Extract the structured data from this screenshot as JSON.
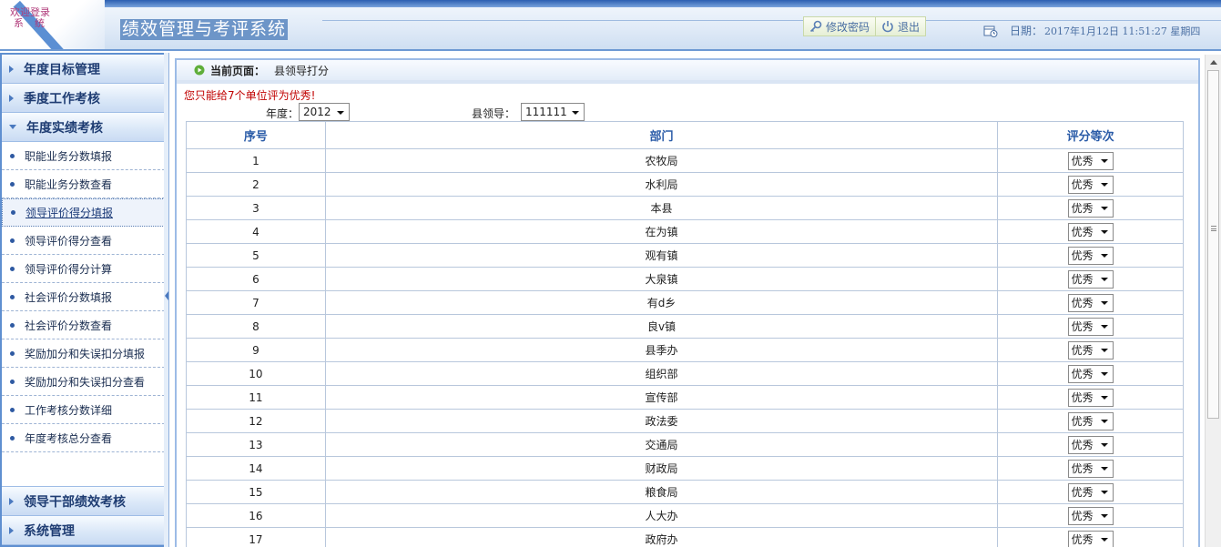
{
  "header": {
    "welcome_line1": "欢迎登录",
    "welcome_line2": "系统",
    "system_title": "绩效管理与考评系统",
    "change_password": "修改密码",
    "logout": "退出",
    "date_label": "日期：",
    "date_value": "2017年1月12日  11:51:27 星期四"
  },
  "sidebar": {
    "groups_top": [
      {
        "label": "年度目标管理"
      },
      {
        "label": "季度工作考核"
      },
      {
        "label": "年度实绩考核"
      }
    ],
    "sub_items": [
      {
        "label": "职能业务分数填报"
      },
      {
        "label": "职能业务分数查看"
      },
      {
        "label": "领导评价得分填报"
      },
      {
        "label": "领导评价得分查看"
      },
      {
        "label": "领导评价得分计算"
      },
      {
        "label": "社会评价分数填报"
      },
      {
        "label": "社会评价分数查看"
      },
      {
        "label": "奖励加分和失误扣分填报"
      },
      {
        "label": "奖励加分和失误扣分查看"
      },
      {
        "label": "工作考核分数详细"
      },
      {
        "label": "年度考核总分查看"
      }
    ],
    "groups_bottom": [
      {
        "label": "领导干部绩效考核"
      },
      {
        "label": "系统管理"
      }
    ]
  },
  "page": {
    "crumb_label": "当前页面：",
    "crumb_value": "县领导打分",
    "notice": "您只能给7个单位评为优秀!",
    "year_label": "年度：",
    "year_value": "2012",
    "leader_label": "县领导：",
    "leader_value": "111111"
  },
  "table": {
    "headers": [
      "序号",
      "部门",
      "评分等次"
    ],
    "rows": [
      {
        "no": "1",
        "dept": "农牧局",
        "rank": "优秀"
      },
      {
        "no": "2",
        "dept": "水利局",
        "rank": "优秀"
      },
      {
        "no": "3",
        "dept": "本县",
        "rank": "优秀"
      },
      {
        "no": "4",
        "dept": "在为镇",
        "rank": "优秀"
      },
      {
        "no": "5",
        "dept": "观有镇",
        "rank": "优秀"
      },
      {
        "no": "6",
        "dept": "大泉镇",
        "rank": "优秀"
      },
      {
        "no": "7",
        "dept": "有d乡",
        "rank": "优秀"
      },
      {
        "no": "8",
        "dept": "良v镇",
        "rank": "优秀"
      },
      {
        "no": "9",
        "dept": "县季办",
        "rank": "优秀"
      },
      {
        "no": "10",
        "dept": "组织部",
        "rank": "优秀"
      },
      {
        "no": "11",
        "dept": "宣传部",
        "rank": "优秀"
      },
      {
        "no": "12",
        "dept": "政法委",
        "rank": "优秀"
      },
      {
        "no": "13",
        "dept": "交通局",
        "rank": "优秀"
      },
      {
        "no": "14",
        "dept": "财政局",
        "rank": "优秀"
      },
      {
        "no": "15",
        "dept": "粮食局",
        "rank": "优秀"
      },
      {
        "no": "16",
        "dept": "人大办",
        "rank": "优秀"
      },
      {
        "no": "17",
        "dept": "政府办",
        "rank": "优秀"
      }
    ]
  },
  "colors": {
    "accent": "#5f8fd0",
    "header_text": "#2b5ca8",
    "notice": "#c00000"
  }
}
